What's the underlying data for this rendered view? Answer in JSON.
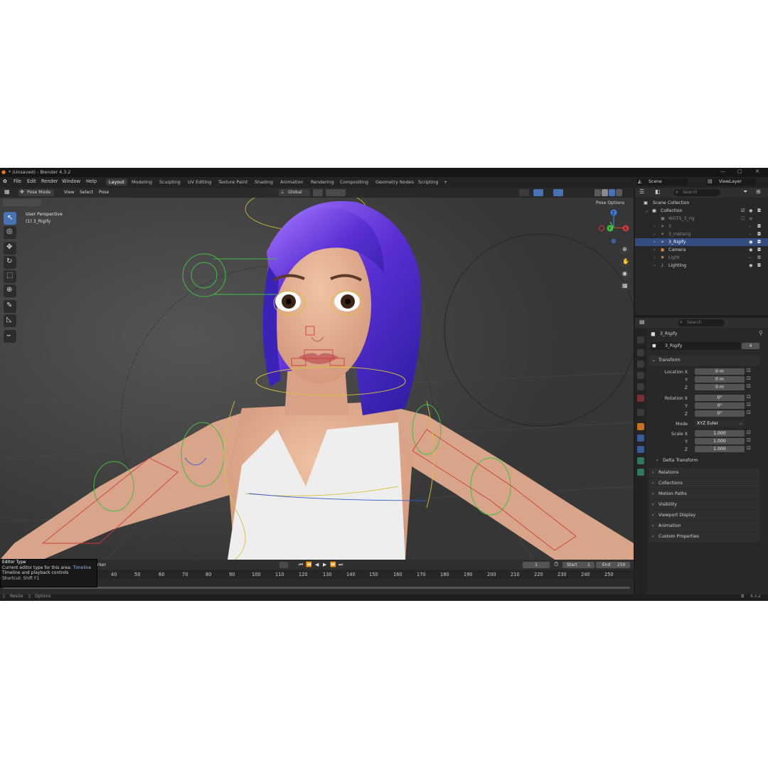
{
  "window": {
    "title": "* (Unsaved) - Blender 4.3.2",
    "controls": [
      "—",
      "▢",
      "✕"
    ]
  },
  "menu": [
    "File",
    "Edit",
    "Render",
    "Window",
    "Help"
  ],
  "workspace_tabs": [
    {
      "label": "Layout",
      "active": true
    },
    {
      "label": "Modeling"
    },
    {
      "label": "Sculpting"
    },
    {
      "label": "UV Editing"
    },
    {
      "label": "Texture Paint"
    },
    {
      "label": "Shading"
    },
    {
      "label": "Animation"
    },
    {
      "label": "Rendering"
    },
    {
      "label": "Compositing"
    },
    {
      "label": "Geometry Nodes"
    },
    {
      "label": "Scripting"
    },
    {
      "label": "+"
    }
  ],
  "scene": {
    "label": "Scene",
    "view_layer": "ViewLayer"
  },
  "viewport": {
    "mode": "Pose Mode",
    "menus": [
      "View",
      "Select",
      "Pose"
    ],
    "orientation": "Global",
    "pose_options": "Pose Options",
    "perspective_label": "User Perspective",
    "active_object_label": "(1) 3_Rigify",
    "gizmo_axes": {
      "x": "X",
      "y": "Y",
      "z": "Z"
    }
  },
  "timeline": {
    "marker_label": "arker",
    "current_frame": "1",
    "start_label": "Start",
    "start": "1",
    "end_label": "End",
    "end": "250",
    "frame_ticks": [
      "40",
      "50",
      "60",
      "70",
      "80",
      "90",
      "100",
      "110",
      "120",
      "130",
      "140",
      "150",
      "160",
      "170",
      "180",
      "190",
      "200",
      "210",
      "220",
      "230",
      "240",
      "250"
    ]
  },
  "tooltip": {
    "title": "Editor Type",
    "line1_prefix": "Current editor type for this area:",
    "line1_value": "Timeline",
    "line2": "Timeline and playback controls",
    "line3": "Shortcut: Shift F1"
  },
  "statusbar": {
    "resize": "Resize",
    "options": "Options",
    "version": "4.3.2"
  },
  "outliner": {
    "search_placeholder": "Search",
    "scene_collection": "Scene Collection",
    "rows": [
      {
        "label": "Collection",
        "indent": 1,
        "muted": false
      },
      {
        "label": "WGTS_3_rig",
        "indent": 2,
        "muted": true
      },
      {
        "label": "3",
        "indent": 2,
        "muted": true
      },
      {
        "label": "3_metarig",
        "indent": 2,
        "muted": true
      },
      {
        "label": "3_Rigify",
        "indent": 2,
        "muted": false,
        "selected": true
      },
      {
        "label": "Camera",
        "indent": 2,
        "muted": false
      },
      {
        "label": "Light",
        "indent": 2,
        "muted": true
      },
      {
        "label": "Lighting",
        "indent": 2,
        "muted": false
      }
    ]
  },
  "properties": {
    "search_placeholder": "Search",
    "object_name": "3_Rigify",
    "data_name": "3_Rigify",
    "users": "4",
    "transform_header": "Transform",
    "location_label": "Location X",
    "rotation_label": "Rotation X",
    "scale_label": "Scale X",
    "axis_y": "Y",
    "axis_z": "Z",
    "location": [
      "0 m",
      "0 m",
      "0 m"
    ],
    "rotation": [
      "0°",
      "0°",
      "0°"
    ],
    "mode_label": "Mode",
    "mode_value": "XYZ Euler",
    "scale": [
      "1.000",
      "1.000",
      "1.000"
    ],
    "delta_transform": "Delta Transform",
    "sections": [
      "Relations",
      "Collections",
      "Motion Paths",
      "Visibility",
      "Viewport Display",
      "Animation",
      "Custom Properties"
    ]
  },
  "colors": {
    "accent": "#4772b3",
    "selection": "#334d80",
    "hair_purple": "#6a3fd1",
    "rig_red": "#d13a3a",
    "rig_green": "#3fbf3f",
    "rig_yellow": "#d8c23a"
  }
}
